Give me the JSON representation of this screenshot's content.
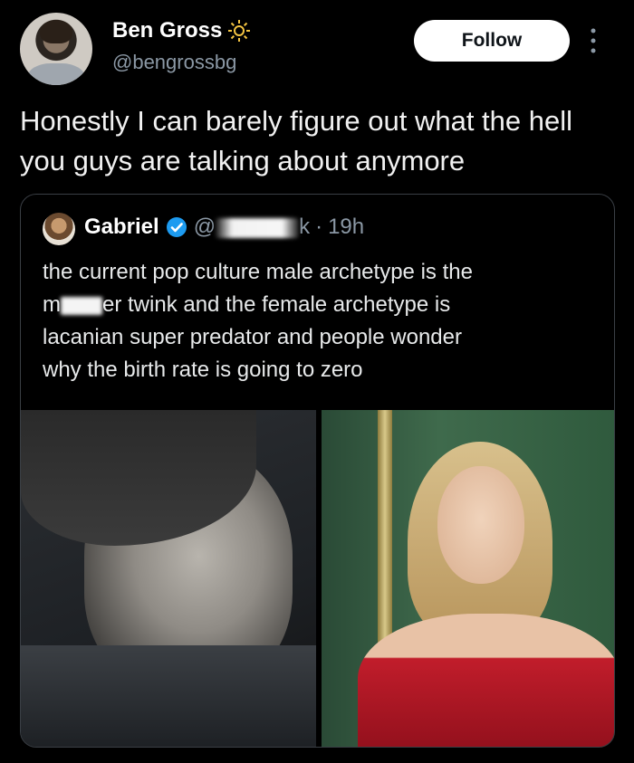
{
  "author": {
    "display_name": "Ben Gross",
    "handle": "@bengrossbg",
    "badge_icon": "sun-icon"
  },
  "follow_label": "Follow",
  "tweet_text": "Honestly I can barely figure out what the hell you guys are talking about anymore",
  "quote": {
    "name": "Gabriel",
    "handle_prefix": "@",
    "handle_suffix": "k",
    "separator": "·",
    "time": "19h",
    "text_line1": "the current pop culture male archetype is the",
    "text_line2_a": "m",
    "text_line2_b": "er twink and the female archetype is",
    "text_line3": "lacanian super predator and people wonder",
    "text_line4": "why the birth rate is going to zero"
  },
  "colors": {
    "background": "#000000",
    "verified": "#1d9bf0",
    "secondary_text": "#8b98a5"
  }
}
